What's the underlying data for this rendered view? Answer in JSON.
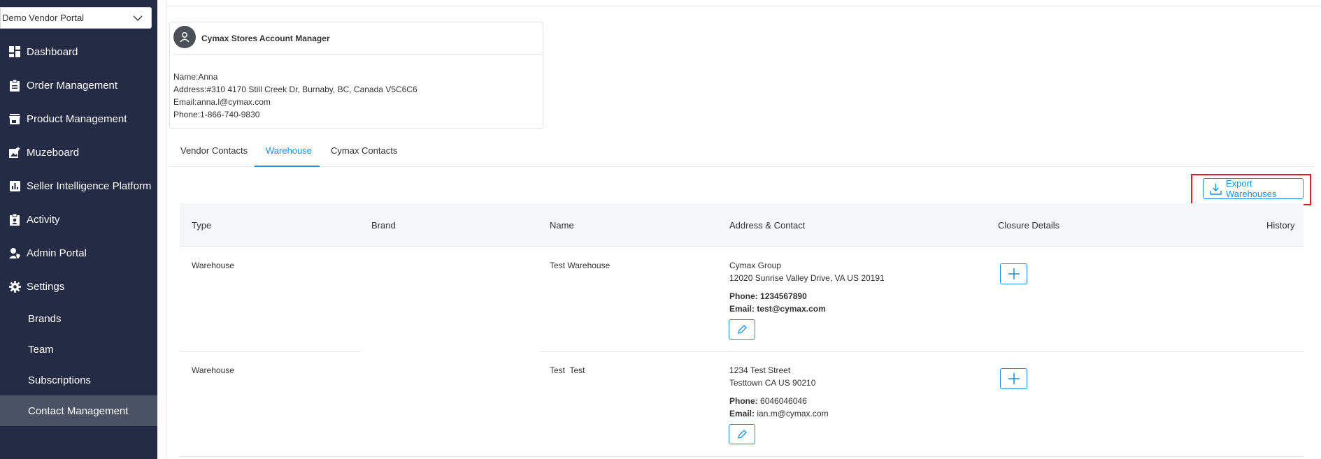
{
  "vendor_select": {
    "value": "Demo Vendor Portal"
  },
  "sidebar": {
    "items": [
      {
        "label": "Dashboard",
        "icon": "dashboard-icon"
      },
      {
        "label": "Order Management",
        "icon": "clipboard-icon"
      },
      {
        "label": "Product Management",
        "icon": "store-icon"
      },
      {
        "label": "Muzeboard",
        "icon": "image-add-icon"
      },
      {
        "label": "Seller Intelligence Platform",
        "icon": "bar-chart-icon"
      },
      {
        "label": "Activity",
        "icon": "person-badge-icon"
      },
      {
        "label": "Admin Portal",
        "icon": "shield-person-icon"
      },
      {
        "label": "Settings",
        "icon": "gear-icon"
      }
    ],
    "sub_items": [
      {
        "label": "Brands"
      },
      {
        "label": "Team"
      },
      {
        "label": "Subscriptions"
      },
      {
        "label": "Contact Management",
        "active": true
      }
    ]
  },
  "manager_card": {
    "title": "Cymax Stores Account Manager",
    "name": "Name:Anna",
    "address": "Address:#310 4170 Still Creek Dr, Burnaby, BC, Canada V5C6C6",
    "email": "Email:anna.l@cymax.com",
    "phone": "Phone:1-866-740-9830"
  },
  "tabs": [
    {
      "label": "Vendor Contacts"
    },
    {
      "label": "Warehouse",
      "active": true
    },
    {
      "label": "Cymax Contacts"
    }
  ],
  "export_button": {
    "label": "Export Warehouses"
  },
  "table": {
    "headers": [
      "Type",
      "Brand",
      "Name",
      "Address & Contact",
      "Closure Details",
      "History"
    ],
    "rows": [
      {
        "type": "Warehouse",
        "brand": "",
        "name": "Test Warehouse",
        "address1": "Cymax Group",
        "address2": "12020 Sunrise Valley Drive, VA US 20191",
        "phone_label": "Phone:",
        "phone": "1234567890",
        "email_label": "Email:",
        "email": "test@cymax.com"
      },
      {
        "type": "Warehouse",
        "brand": "",
        "name": "Test  Test",
        "address1": "1234 Test Street",
        "address2": "Testtown CA US 90210",
        "phone_label": "Phone:",
        "phone": "6046046046",
        "email_label": "Email:",
        "email": "ian.m@cymax.com"
      }
    ]
  },
  "colors": {
    "sidebar_bg": "#232b45",
    "sidebar_active": "#4a5265",
    "accent": "#1f8ee6",
    "highlight": "#e02020"
  }
}
